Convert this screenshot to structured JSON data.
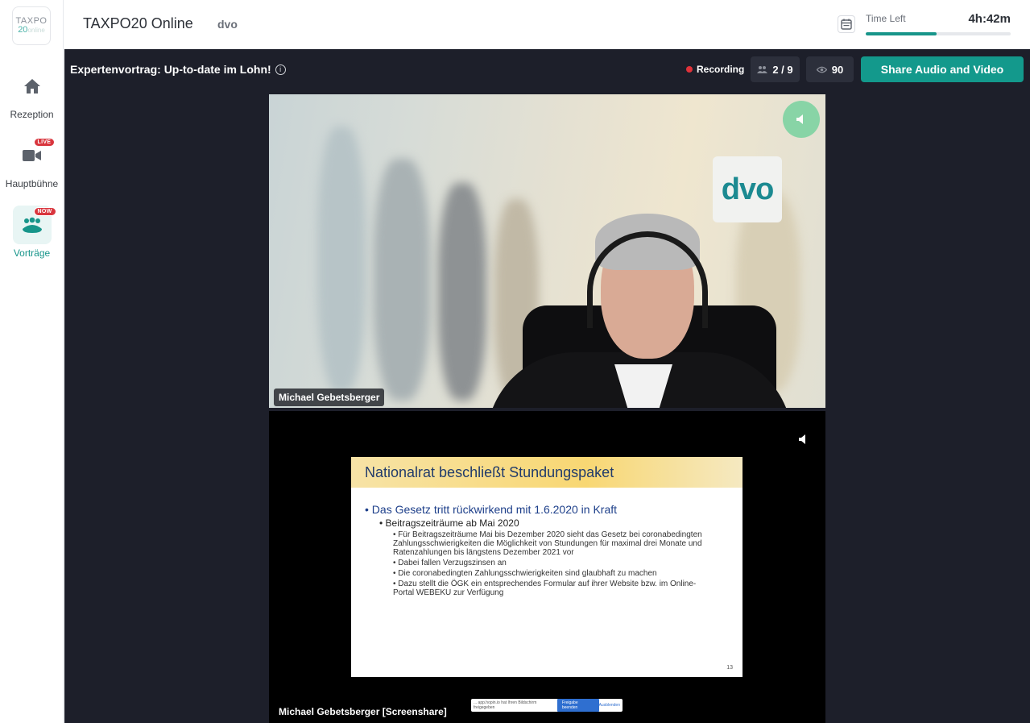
{
  "sidebar": {
    "logo": {
      "line1": "TAXPO",
      "line2": "20",
      "line2_suffix": "online"
    },
    "items": [
      {
        "label": "Rezeption",
        "icon": "home-icon",
        "badge": ""
      },
      {
        "label": "Hauptbühne",
        "icon": "video-camera-icon",
        "badge": "LIVE"
      },
      {
        "label": "Vorträge",
        "icon": "audience-icon",
        "badge": "NOW"
      }
    ]
  },
  "header": {
    "title": "TAXPO20 Online",
    "organizer": "dvo",
    "time_left_label": "Time Left",
    "time_left_value": "4h:42m",
    "time_progress": 0.49
  },
  "stage": {
    "session_title": "Expertenvortrag: Up-to-date im Lohn!",
    "recording_label": "Recording",
    "speakers_count": "2 / 9",
    "viewers_count": "90",
    "share_button": "Share Audio and Video"
  },
  "tiles": {
    "camera": {
      "name": "Michael Gebetsberger",
      "sign": "dvo"
    },
    "screenshare": {
      "name": "Michael Gebetsberger [Screenshare]",
      "slide_title": "Nationalrat beschließt Stundungspaket",
      "bullet1": "• Das Gesetz tritt rückwirkend mit 1.6.2020 in Kraft",
      "bullet2": "• Beitragszeiträume ab Mai 2020",
      "sub_bullets": [
        "• Für Beitragszeiträume Mai bis Dezember 2020 sieht das Gesetz bei coronabedingten Zahlungsschwierigkeiten die Möglichkeit von Stundungen für maximal drei Monate und Ratenzahlungen bis längstens Dezember 2021 vor",
        "• Dabei fallen Verzugszinsen an",
        "• Die coronabedingten Zahlungsschwierigkeiten sind glaubhaft zu machen",
        "• Dazu stellt die ÖGK ein entsprechendes Formular auf ihrer Website bzw. im Online-Portal WEBEKU zur Verfügung"
      ],
      "slide_number": "13",
      "share_notice": "... app.hopin.io hat Ihren Bildschirm freigegeben",
      "share_notice_stop": "Freigabe beenden",
      "share_notice_hide": "Ausblenden"
    }
  },
  "colors": {
    "accent": "#13998c",
    "stage_bg": "#1d1f2a",
    "live_badge": "#d9363e"
  }
}
